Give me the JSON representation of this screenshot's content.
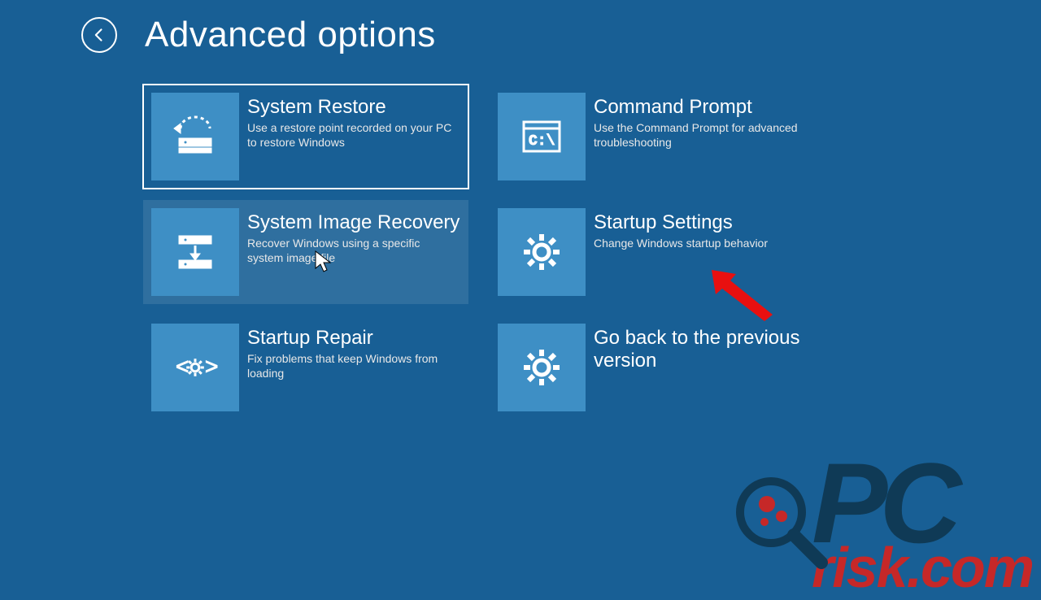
{
  "header": {
    "title": "Advanced options"
  },
  "tiles": {
    "system_restore": {
      "title": "System Restore",
      "desc": "Use a restore point recorded on your PC to restore Windows"
    },
    "command_prompt": {
      "title": "Command Prompt",
      "desc": "Use the Command Prompt for advanced troubleshooting"
    },
    "system_image_recovery": {
      "title": "System Image Recovery",
      "desc": "Recover Windows using a specific system image file"
    },
    "startup_settings": {
      "title": "Startup Settings",
      "desc": "Change Windows startup behavior"
    },
    "startup_repair": {
      "title": "Startup Repair",
      "desc": "Fix problems that keep Windows from loading"
    },
    "go_back": {
      "title": "Go back to the previous version",
      "desc": ""
    }
  },
  "watermark": {
    "line1": "PC",
    "line2": "risk.com"
  }
}
